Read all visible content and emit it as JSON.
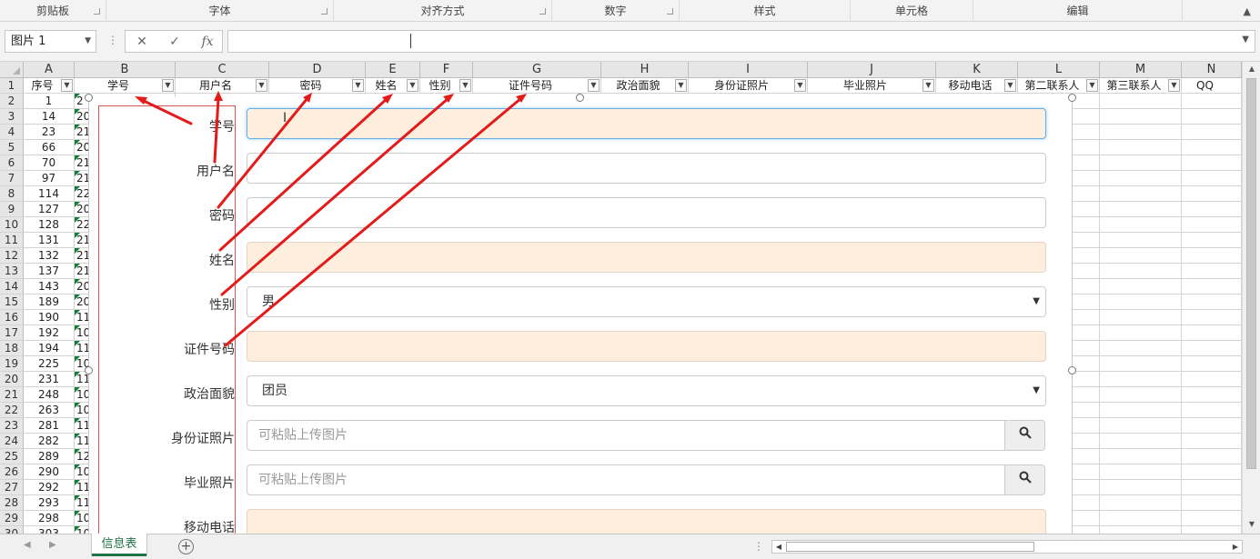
{
  "ribbon": {
    "groups": [
      "剪贴板",
      "字体",
      "对齐方式",
      "数字",
      "样式",
      "单元格",
      "编辑"
    ]
  },
  "formula_bar": {
    "name_box": "图片 1",
    "cancel_icon": "close-icon",
    "enter_icon": "check-icon",
    "fx_label": "fx",
    "content": ""
  },
  "columns": [
    "A",
    "B",
    "C",
    "D",
    "E",
    "F",
    "G",
    "H",
    "I",
    "J",
    "K",
    "L",
    "M",
    "N"
  ],
  "header_row": [
    "序号",
    "学号",
    "用户名",
    "密码",
    "姓名",
    "性别",
    "证件号码",
    "政治面貌",
    "身份证照片",
    "毕业照片",
    "移动电话",
    "第二联系人",
    "第三联系人",
    "QQ"
  ],
  "row_numbers": [
    "1",
    "2",
    "3",
    "4",
    "5",
    "6",
    "7",
    "8",
    "9",
    "10",
    "11",
    "12",
    "13",
    "14",
    "15",
    "16",
    "17",
    "18",
    "19",
    "20",
    "21",
    "22",
    "23",
    "24",
    "25",
    "26",
    "27",
    "28",
    "29",
    "30"
  ],
  "col_a_values": [
    "1",
    "14",
    "23",
    "66",
    "70",
    "97",
    "114",
    "127",
    "128",
    "131",
    "132",
    "137",
    "143",
    "189",
    "190",
    "192",
    "194",
    "225",
    "231",
    "248",
    "263",
    "281",
    "282",
    "289",
    "290",
    "292",
    "293",
    "298",
    "303"
  ],
  "col_b_partial": [
    "2",
    "20",
    "21",
    "20",
    "21",
    "21",
    "22",
    "20",
    "22",
    "21",
    "21",
    "21",
    "20",
    "20",
    "11",
    "10",
    "11",
    "10",
    "11",
    "10",
    "10",
    "11",
    "11",
    "12",
    "10",
    "11",
    "11",
    "10",
    "10"
  ],
  "form": {
    "labels": [
      "学号",
      "用户名",
      "密码",
      "姓名",
      "性别",
      "证件号码",
      "政治面貌",
      "身份证照片",
      "毕业照片",
      "移动电话"
    ],
    "gender_value": "男",
    "political_value": "团员",
    "upload_placeholder": "可粘贴上传图片",
    "search_icon": "search-icon"
  },
  "sheet": {
    "tab_name": "信息表",
    "add_icon": "plus-icon"
  }
}
